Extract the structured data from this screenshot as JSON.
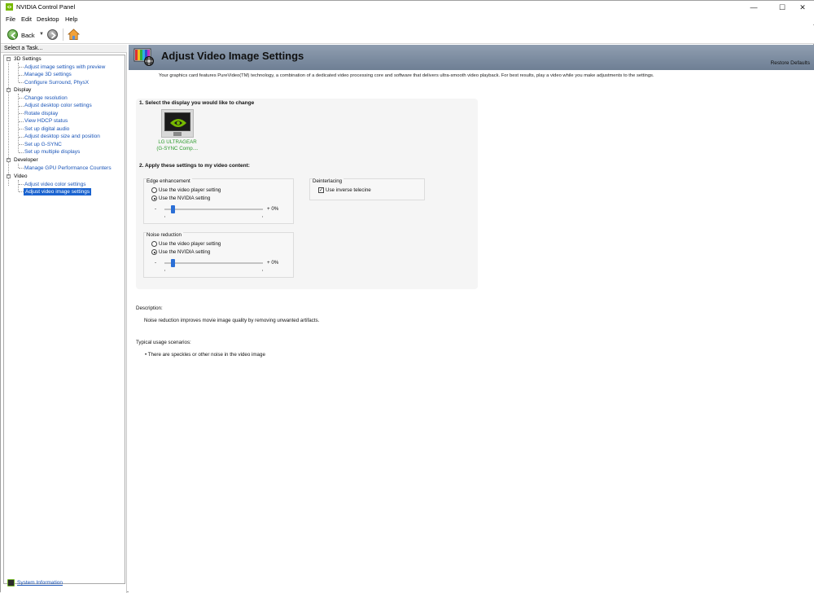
{
  "window": {
    "title": "NVIDIA Control Panel",
    "minimize": "—",
    "maximize": "☐",
    "close": "✕"
  },
  "menu": [
    "File",
    "Edit",
    "Desktop",
    "Help"
  ],
  "toolbar": {
    "back_label": "Back"
  },
  "sidebar": {
    "header": "Select a Task...",
    "tree": [
      {
        "category": "3D Settings",
        "items": [
          "Adjust image settings with preview",
          "Manage 3D settings",
          "Configure Surround, PhysX"
        ]
      },
      {
        "category": "Display",
        "items": [
          "Change resolution",
          "Adjust desktop color settings",
          "Rotate display",
          "View HDCP status",
          "Set up digital audio",
          "Adjust desktop size and position",
          "Set up G-SYNC",
          "Set up multiple displays"
        ]
      },
      {
        "category": "Developer",
        "items": [
          "Manage GPU Performance Counters"
        ]
      },
      {
        "category": "Video",
        "items": [
          "Adjust video color settings",
          "Adjust video image settings"
        ]
      }
    ],
    "selected": "Adjust video image settings",
    "system_info": "System Information"
  },
  "page": {
    "title": "Adjust Video Image Settings",
    "restore": "Restore Defaults",
    "intro": "Your graphics card features PureVideo(TM) technology, a combination of a dedicated video processing core and software that delivers ultra-smooth video playback. For best results, play a video while you make adjustments to the settings.",
    "step1": "1. Select the display you would like to change",
    "display_name_1": "LG ULTRAGEAR",
    "display_name_2": "(G-SYNC Comp....",
    "step2": "2. Apply these settings to my video content:",
    "edge": {
      "title": "Edge enhancement",
      "option_player": "Use the video player setting",
      "option_nvidia": "Use the NVIDIA setting",
      "selected": "nvidia",
      "min_label": "-",
      "value_label": "+ 0%",
      "value": 0
    },
    "noise": {
      "title": "Noise reduction",
      "option_player": "Use the video player setting",
      "option_nvidia": "Use the NVIDIA setting",
      "selected": "nvidia",
      "min_label": "-",
      "value_label": "+ 0%",
      "value": 0
    },
    "deinterlacing": {
      "title": "Deinterlacing",
      "checkbox_label": "Use inverse telecine",
      "checked": true
    },
    "description_heading": "Description:",
    "description_text": "Noise reduction improves movie image quality by removing unwanted artifacts.",
    "usage_heading": "Typical usage scenarios:",
    "usage_items": [
      "• There are speckles or other noise in the video image"
    ]
  },
  "colors": {
    "link": "#1a55b8",
    "selection": "#1a63d0",
    "nvidia_green": "#76b900",
    "banner": "#7d8ca0",
    "slider_thumb": "#2b6fd6"
  }
}
